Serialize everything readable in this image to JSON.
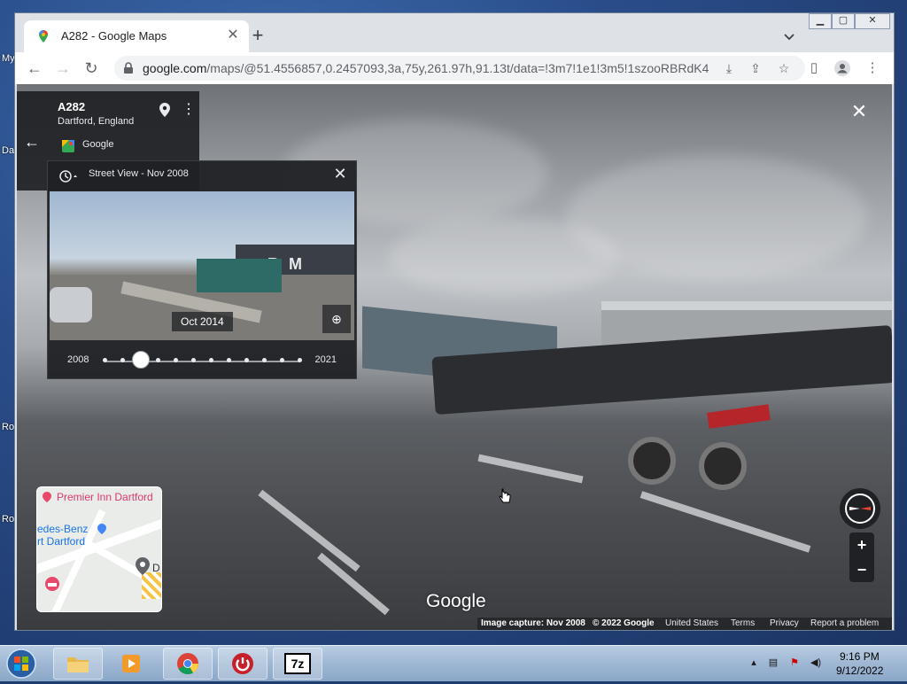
{
  "desktop": {
    "labels": [
      "My",
      "Da",
      "Ro",
      "Ro"
    ]
  },
  "browser": {
    "tab_title": "A282 - Google Maps",
    "url_host": "google.com",
    "url_path": "/maps/@51.4556857,0.2457093,3a,75y,261.97h,91.13t/data=!3m7!1e1!3m5!1szooRBRdK4...",
    "window_controls": [
      "minimize",
      "maximize",
      "close"
    ]
  },
  "place_card": {
    "title": "A282",
    "subtitle": "Dartford, England",
    "source": "Google"
  },
  "time_machine": {
    "header": "Street View - Nov 2008",
    "selected_date": "Oct 2014",
    "year_start": "2008",
    "year_end": "2021",
    "building_text": "R M",
    "slider_stops": 12,
    "selected_index": 2
  },
  "minimap": {
    "labels": [
      "Premier Inn Dartford",
      "edes-Benz",
      "rt Dartford",
      "D"
    ]
  },
  "street_view": {
    "watermark": "Google",
    "footer": {
      "capture": "Image capture: Nov 2008",
      "copyright": "© 2022 Google",
      "region": "United States",
      "terms": "Terms",
      "privacy": "Privacy",
      "report": "Report a problem"
    },
    "zoom_in": "+",
    "zoom_out": "−"
  },
  "taskbar": {
    "time": "9:16 PM",
    "date": "9/12/2022",
    "apps": [
      "file-explorer",
      "media-player",
      "chrome",
      "power-shutdown",
      "7-zip"
    ],
    "app_7zip_label": "7z"
  },
  "colors": {
    "accent": "#1a73e8",
    "panel": "#202124",
    "pin_red": "#ea4335"
  }
}
